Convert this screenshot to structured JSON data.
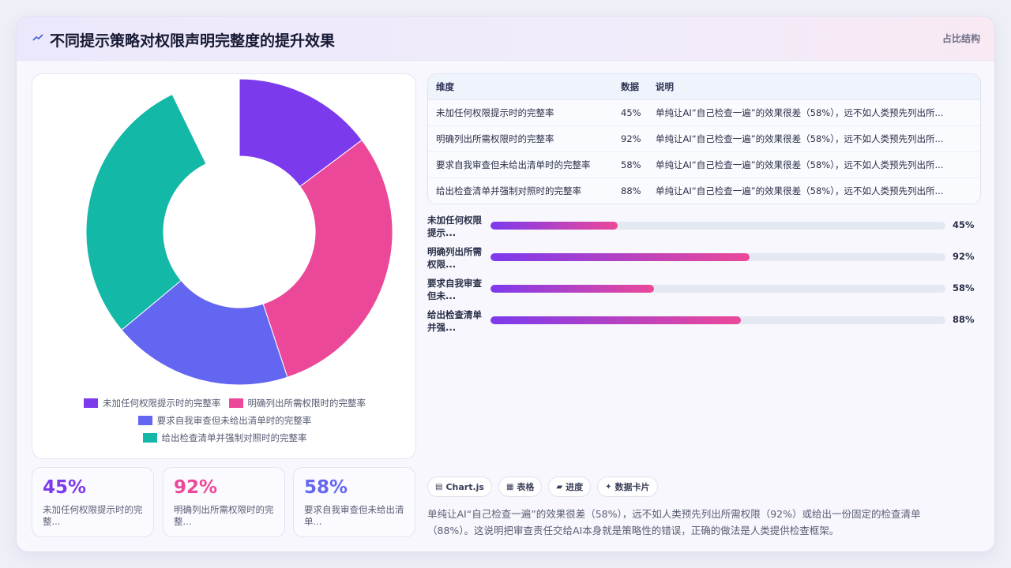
{
  "header": {
    "title": "不同提示策略对权限声明完整度的提升效果",
    "tag": "占比结构"
  },
  "colors": {
    "purple": "#7c3aed",
    "pink": "#ec4899",
    "indigo": "#6366f1",
    "teal": "#14b8a6"
  },
  "chart_data": {
    "type": "pie",
    "variant": "doughnut",
    "categories": [
      "未加任何权限提示时的完整率",
      "明确列出所需权限时的完整率",
      "要求自我审查但未给出清单时的完整率",
      "给出检查清单并强制对照时的完整率"
    ],
    "values": [
      45,
      92,
      58,
      88
    ],
    "colors": [
      "#7c3aed",
      "#ec4899",
      "#6366f1",
      "#14b8a6"
    ],
    "legend_position": "bottom"
  },
  "legend": {
    "items": [
      {
        "label": "未加任何权限提示时的完整率",
        "color": "#7c3aed"
      },
      {
        "label": "明确列出所需权限时的完整率",
        "color": "#ec4899"
      },
      {
        "label": "要求自我审查但未给出清单时的完整率",
        "color": "#6366f1"
      },
      {
        "label": "给出检查清单并强制对照时的完整率",
        "color": "#14b8a6"
      }
    ]
  },
  "stats": [
    {
      "value": "45%",
      "label": "未加任何权限提示时的完整...",
      "color": "#7c3aed"
    },
    {
      "value": "92%",
      "label": "明确列出所需权限时的完整...",
      "color": "#ec4899"
    },
    {
      "value": "58%",
      "label": "要求自我审查但未给出清单...",
      "color": "#6366f1"
    }
  ],
  "table": {
    "headers": [
      "维度",
      "数据",
      "说明"
    ],
    "rows": [
      [
        "未加任何权限提示时的完整率",
        "45%",
        "单纯让AI“自己检查一遍”的效果很差（58%），远不如人类预先列出所..."
      ],
      [
        "明确列出所需权限时的完整率",
        "92%",
        "单纯让AI“自己检查一遍”的效果很差（58%），远不如人类预先列出所..."
      ],
      [
        "要求自我审查但未给出清单时的完整率",
        "58%",
        "单纯让AI“自己检查一遍”的效果很差（58%），远不如人类预先列出所..."
      ],
      [
        "给出检查清单并强制对照时的完整率",
        "88%",
        "单纯让AI“自己检查一遍”的效果很差（58%），远不如人类预先列出所..."
      ]
    ]
  },
  "progress": [
    {
      "label": "未加任何权限提示...",
      "value": 0.28,
      "pct": "45%"
    },
    {
      "label": "明确列出所需权限...",
      "value": 0.57,
      "pct": "92%"
    },
    {
      "label": "要求自我审查但未...",
      "value": 0.36,
      "pct": "58%"
    },
    {
      "label": "给出检查清单并强...",
      "value": 0.55,
      "pct": "88%"
    }
  ],
  "chips": [
    {
      "icon": "chart-icon",
      "label": "Chart.js"
    },
    {
      "icon": "table-icon",
      "label": "表格"
    },
    {
      "icon": "progress-icon",
      "label": "进度"
    },
    {
      "icon": "card-icon",
      "label": "数据卡片"
    }
  ],
  "description": "单纯让AI“自己检查一遍”的效果很差（58%），远不如人类预先列出所需权限（92%）或给出一份固定的检查清单（88%）。这说明把审查责任交给AI本身就是策略性的错误，正确的做法是人类提供检查框架。"
}
